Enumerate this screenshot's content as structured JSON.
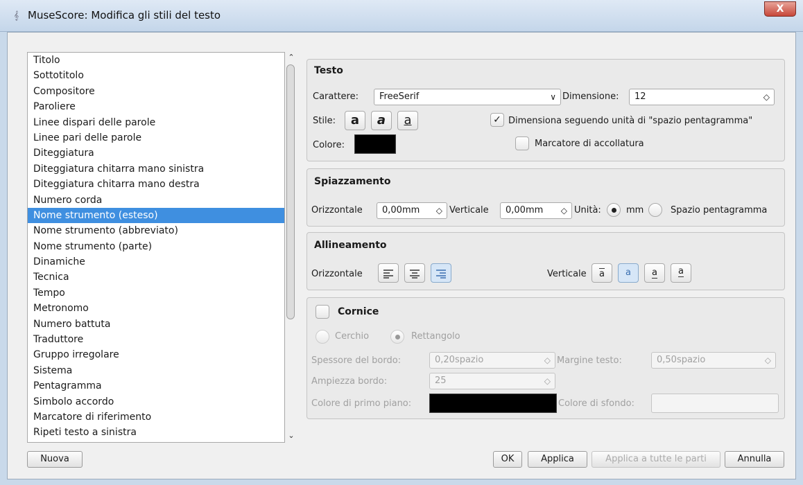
{
  "window": {
    "title": "MuseScore: Modifica gli stili del testo",
    "close_label": "X",
    "app_icon": "musescore-icon"
  },
  "list": {
    "items": [
      "Titolo",
      "Sottotitolo",
      "Compositore",
      "Paroliere",
      "Linee dispari delle parole",
      "Linee pari delle parole",
      "Diteggiatura",
      "Diteggiatura chitarra mano sinistra",
      "Diteggiatura chitarra mano destra",
      "Numero corda",
      "Nome strumento (esteso)",
      "Nome strumento (abbreviato)",
      "Nome strumento (parte)",
      "Dinamiche",
      "Tecnica",
      "Tempo",
      "Metronomo",
      "Numero battuta",
      "Traduttore",
      "Gruppo irregolare",
      "Sistema",
      "Pentagramma",
      "Simbolo accordo",
      "Marcatore di riferimento",
      "Ripeti testo a sinistra"
    ],
    "selected_index": 10
  },
  "testo": {
    "title": "Testo",
    "font_label": "Carattere:",
    "font_value": "FreeSerif",
    "size_label": "Dimensione:",
    "size_value": "12",
    "style_label": "Stile:",
    "bold_glyph": "a",
    "italic_glyph": "a",
    "underline_glyph": "a",
    "spatium_label": "Dimensiona seguendo unità di \"spazio pentagramma\"",
    "color_label": "Colore:",
    "color_value": "#000000",
    "bracket_label": "Marcatore di accollatura",
    "check_glyph": "✓"
  },
  "spiazzamento": {
    "title": "Spiazzamento",
    "horiz_label": "Orizzontale",
    "horiz_value": "0,00mm",
    "vert_label": "Verticale",
    "vert_value": "0,00mm",
    "unit_label": "Unità:",
    "unit_mm": "mm",
    "unit_spatium": "Spazio pentagramma"
  },
  "allineamento": {
    "title": "Allineamento",
    "horiz_label": "Orizzontale",
    "vert_label": "Verticale",
    "v_glyph": "a"
  },
  "cornice": {
    "title": "Cornice",
    "circle_label": "Cerchio",
    "rect_label": "Rettangolo",
    "border_label": "Spessore del bordo:",
    "border_value": "0,20spazio",
    "margin_label": "Margine testo:",
    "margin_value": "0,50spazio",
    "width_label": "Ampiezza bordo:",
    "width_value": "25",
    "fg_label": "Colore di primo piano:",
    "fg_color": "#000000",
    "bg_label": "Colore di sfondo:"
  },
  "buttons": {
    "new": "Nuova",
    "ok": "OK",
    "apply": "Applica",
    "apply_all": "Applica a tutte le parti",
    "cancel": "Annulla"
  },
  "glyphs": {
    "up": "⌃",
    "down": "⌄",
    "combo": "∨",
    "spin": "◇"
  }
}
